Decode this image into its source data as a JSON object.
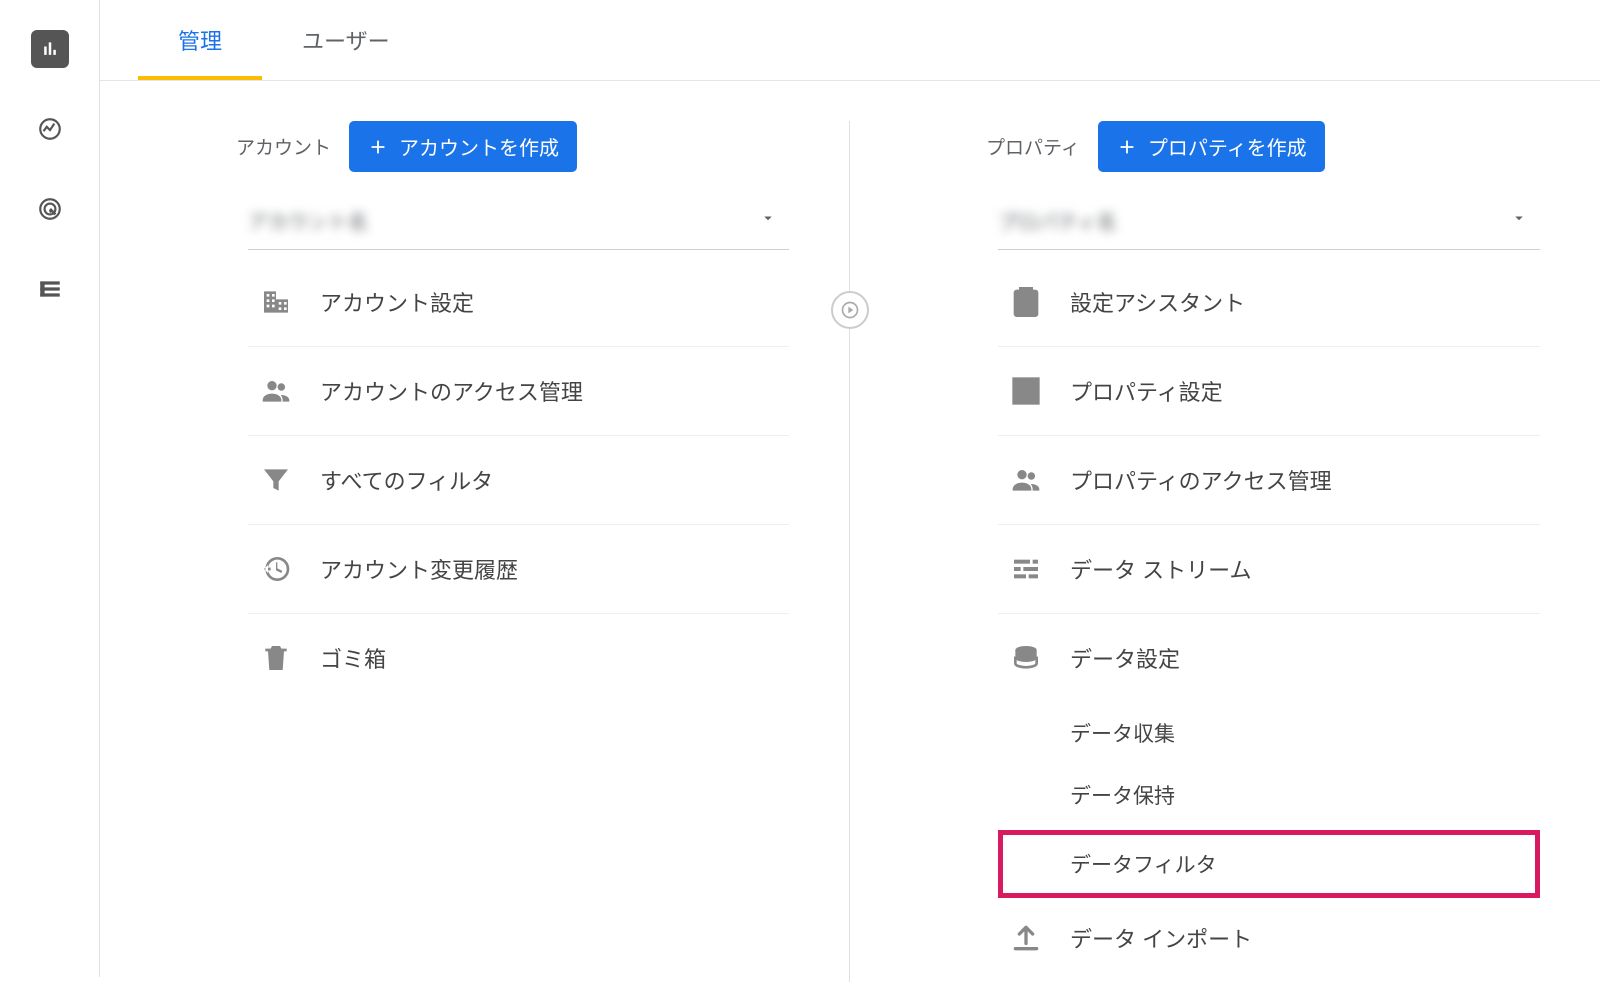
{
  "tabs": {
    "admin": "管理",
    "user": "ユーザー"
  },
  "account_column": {
    "label": "アカウント",
    "create_button": "アカウントを作成",
    "selected": "アカウント名",
    "items": [
      {
        "label": "アカウント設定"
      },
      {
        "label": "アカウントのアクセス管理"
      },
      {
        "label": "すべてのフィルタ"
      },
      {
        "label": "アカウント変更履歴"
      },
      {
        "label": "ゴミ箱"
      }
    ]
  },
  "property_column": {
    "label": "プロパティ",
    "create_button": "プロパティを作成",
    "selected": "プロパティ名",
    "items": [
      {
        "label": "設定アシスタント"
      },
      {
        "label": "プロパティ設定"
      },
      {
        "label": "プロパティのアクセス管理"
      },
      {
        "label": "データ ストリーム"
      },
      {
        "label": "データ設定"
      }
    ],
    "sub_items": [
      {
        "label": "データ収集"
      },
      {
        "label": "データ保持"
      },
      {
        "label": "データフィルタ"
      }
    ],
    "import_item": {
      "label": "データ インポート"
    }
  }
}
